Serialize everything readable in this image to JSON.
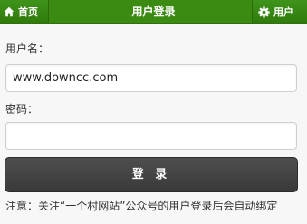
{
  "header": {
    "home_label": "首页",
    "title": "用户登录",
    "user_label": "用户"
  },
  "icons": {
    "home": "home-icon",
    "user": "gear-icon"
  },
  "colors": {
    "header_bg": "#3b8b12",
    "button_bg": "#444444",
    "page_bg": "#f7f7f7"
  },
  "form": {
    "username_label": "用户名：",
    "username_value": "www.downcc.com",
    "password_label": "密码：",
    "password_value": "",
    "submit_label": "登 录"
  },
  "notice": "注意：关注“一个村网站”公众号的用户登录后会自动绑定"
}
